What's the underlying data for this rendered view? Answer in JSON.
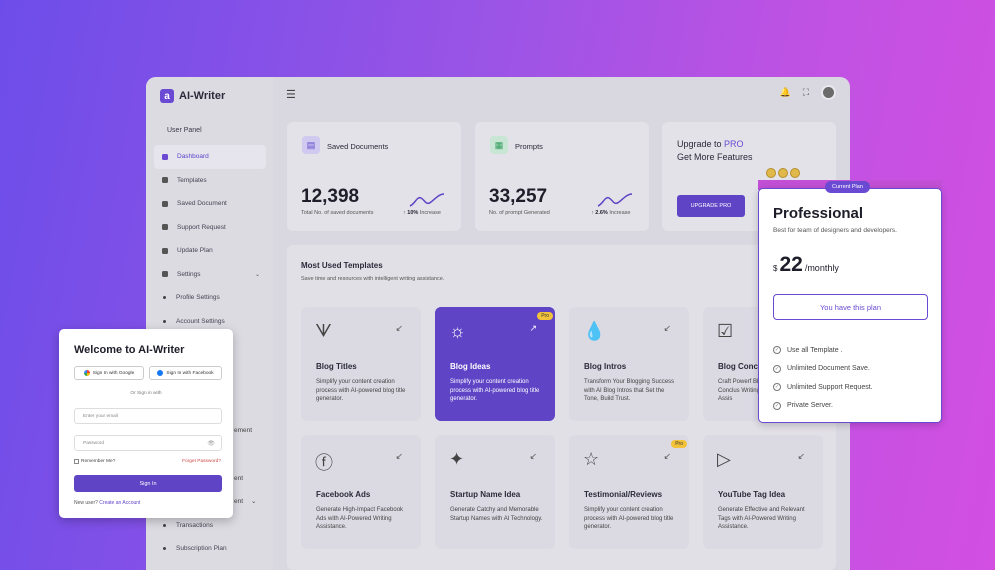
{
  "app": {
    "name": "AI-Writer",
    "logo_letter": "a"
  },
  "sidebar": {
    "panel_label": "User Panel",
    "items": [
      {
        "label": "Dashboard",
        "icon": "dashboard-icon",
        "active": true
      },
      {
        "label": "Templates",
        "icon": "template-icon"
      },
      {
        "label": "Saved Document",
        "icon": "document-icon"
      },
      {
        "label": "Support Request",
        "icon": "support-icon"
      },
      {
        "label": "Update Plan",
        "icon": "plan-icon"
      },
      {
        "label": "Settings",
        "icon": "settings-icon",
        "expandable": true
      },
      {
        "label": "Profile Settings",
        "sub": true
      },
      {
        "label": "Account Settings",
        "sub": true
      },
      {
        "label": "Transactions",
        "sub": true
      },
      {
        "label": "Subscription Plan",
        "sub": true
      }
    ],
    "partial_labels": [
      "ement",
      "ent",
      "ent"
    ]
  },
  "stats": [
    {
      "title": "Saved Documents",
      "value": "12,398",
      "subtitle": "Total No. of saved documents",
      "change": "10%",
      "change_label": "Increase",
      "icon": "document-icon"
    },
    {
      "title": "Prompts",
      "value": "33,257",
      "subtitle": "No. of prompt Generated",
      "change": "2.6%",
      "change_label": "Increase",
      "icon": "keyboard-icon"
    }
  ],
  "upgrade": {
    "line1_prefix": "Upgrade to ",
    "line1_accent": "PRO",
    "line2": "Get More Features",
    "button": "UPGRADE PRO"
  },
  "templates_section": {
    "title": "Most Used Templates",
    "subtitle": "Save time and resources with intelligent writing assistance.",
    "cards": [
      {
        "name": "Blog Titles",
        "desc": "Simplify your content creation process with AI-powered blog title generator.",
        "icon": "rss-icon",
        "glyph": "ᗐ"
      },
      {
        "name": "Blog Ideas",
        "desc": "Simplify your content creation process with AI-powered blog title generator.",
        "icon": "lightbulb-icon",
        "glyph": "☼",
        "pro": "Pro",
        "highlight": true
      },
      {
        "name": "Blog Intros",
        "desc": "Transform Your Blogging Success with AI Blog Intros that Set the Tone, Build Trust.",
        "icon": "drops-icon",
        "glyph": "💧"
      },
      {
        "name": "Blog Conc",
        "desc": "Craft Powerf Blog Conclus Writing Assis",
        "icon": "chat-check-icon",
        "glyph": "☑"
      },
      {
        "name": "Facebook Ads",
        "desc": "Generate High-Impact Facebook Ads with AI-Powered Writing Assistance.",
        "icon": "facebook-icon",
        "glyph": "ⓕ"
      },
      {
        "name": "Startup Name Idea",
        "desc": "Generate Catchy and Memorable Startup Names with AI Technology.",
        "icon": "sparkles-icon",
        "glyph": "✦"
      },
      {
        "name": "Testimonial/Reviews",
        "desc": "Simplify your content creation process with AI-powered blog title generator.",
        "icon": "star-icon",
        "glyph": "☆",
        "pro": "Pro"
      },
      {
        "name": "YouTube Tag Idea",
        "desc": "Generate Effective and Relevant Tags with AI-Powered Writing Assistance.",
        "icon": "youtube-icon",
        "glyph": "▷"
      }
    ]
  },
  "plan": {
    "tag": "Current Plan",
    "name": "Professional",
    "desc": "Best for team of designers and developers.",
    "currency": "$",
    "price": "22",
    "period": "/monthly",
    "button": "You have this plan",
    "features": [
      "Use all Template .",
      "Unlimited Document Save.",
      "Unlimited Support Request.",
      "Private Server."
    ]
  },
  "login": {
    "title": "Welcome to AI-Writer",
    "google": "Sign In with Google",
    "facebook": "Sign In with Facebook",
    "or": "Or Sign in with",
    "email_placeholder": "Enter your email",
    "password_placeholder": "Password",
    "remember": "Remember Me?",
    "forgot": "Forget Password?",
    "signin": "Sign In",
    "new_user": "New user? ",
    "create": "Create an Account"
  }
}
